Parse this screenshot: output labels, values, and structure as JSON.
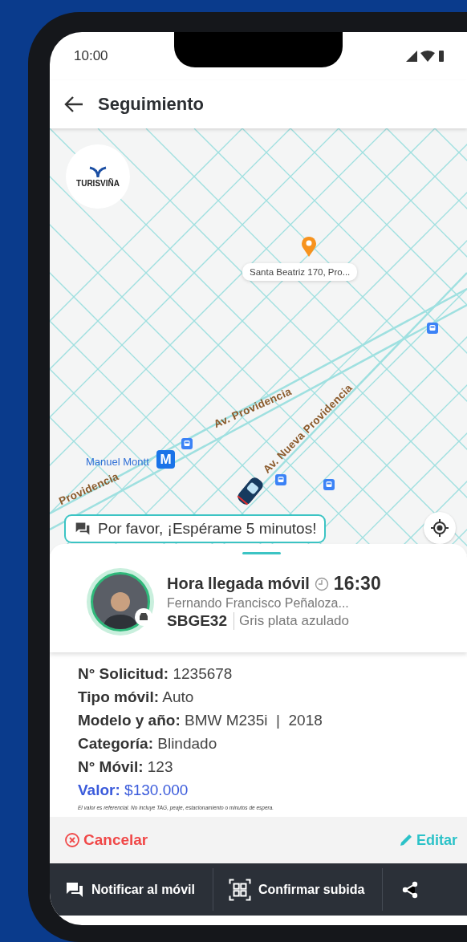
{
  "status_bar": {
    "time": "10:00"
  },
  "app_bar": {
    "title": "Seguimiento"
  },
  "map": {
    "logo": "TURISVIÑA",
    "destination": "Santa Beatriz 170, Pro...",
    "streets": [
      "Av. Providencia",
      "Av. Nueva Providencia",
      "Providencia"
    ],
    "metro_station": "Manuel Montt",
    "metro_sign": "M",
    "message": "Por favor, ¡Espérame 5 minutos!"
  },
  "driver": {
    "arrival_label": "Hora llegada móvil",
    "arrival_time": "16:30",
    "name": "Fernando Francisco Peñaloza...",
    "plate": "SBGE32",
    "vehicle_color": "Gris plata azulado"
  },
  "details": [
    {
      "label": "N° Solicitud:",
      "value": "1235678",
      "kind": "plain"
    },
    {
      "label": "Tipo móvil:",
      "value": "Auto",
      "kind": "plain"
    },
    {
      "label": "Modelo y año:",
      "value": "BMW M235i  |  2018",
      "kind": "plain"
    },
    {
      "label": "Categoría:",
      "value": "Blindado",
      "kind": "plain"
    },
    {
      "label": "N° Móvil:",
      "value": "123",
      "kind": "plain"
    },
    {
      "label": "Valor:",
      "value": "$130.000",
      "kind": "price"
    }
  ],
  "disclaimer": "El valor es referencial. No incluye TAG,  peaje, estacionamiento o minutos de espera.",
  "actions": {
    "cancel": "Cancelar",
    "edit": "Editar"
  },
  "bottom_bar": [
    {
      "kind": "notify",
      "label": "Notificar al móvil"
    },
    {
      "kind": "confirm",
      "label": "Confirmar subida"
    },
    {
      "kind": "share"
    }
  ]
}
